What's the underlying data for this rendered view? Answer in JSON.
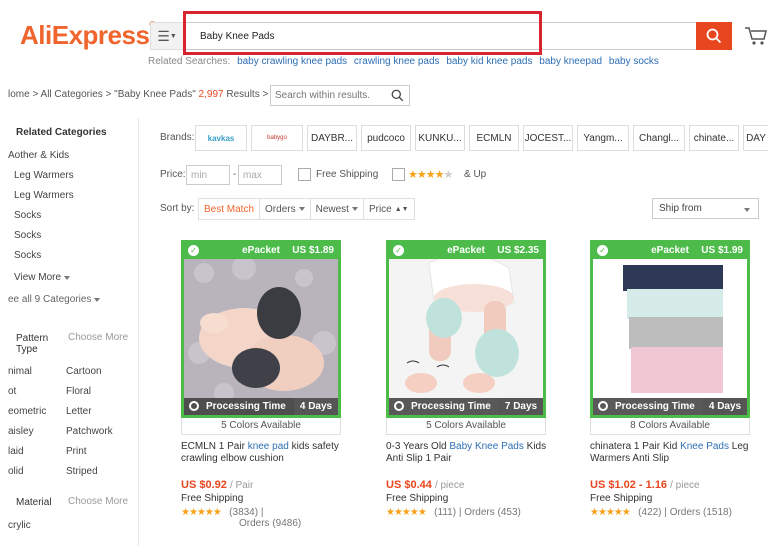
{
  "header": {
    "logo": "AliExpress",
    "logo_tm": "®",
    "search_value": "Baby Knee Pads",
    "related_label": "Related Searches:",
    "related": [
      "baby crawling knee pads",
      "crawling knee pads",
      "baby kid knee pads",
      "baby kneepad",
      "baby socks"
    ]
  },
  "breadcrumb": {
    "path": "lome > All Categories > \"Baby Knee Pads\"",
    "count": "2,997",
    "results": "Results >",
    "within_placeholder": "Search within results."
  },
  "sidebar": {
    "related_title": "Related Categories",
    "categories": [
      "Aother & Kids",
      "Leg Warmers",
      "Leg Warmers",
      "Socks",
      "Socks",
      "Socks"
    ],
    "view_more": "View More",
    "see_all": "ee all 9 Categories",
    "pattern_title_1": "Pattern",
    "pattern_title_2": "Type",
    "choose_more": "Choose More",
    "patterns_left": [
      "nimal",
      "ot",
      "eometric",
      "aisley",
      "laid",
      "olid"
    ],
    "patterns_right": [
      "Cartoon",
      "Floral",
      "Letter",
      "Patchwork",
      "Print",
      "Striped"
    ],
    "material_title": "Material",
    "material_choose": "Choose More",
    "materials": [
      "crylic"
    ]
  },
  "filters": {
    "brands_label": "Brands:",
    "brands": [
      "kavkas",
      "babygo",
      "DAYBR...",
      "pudcoco",
      "KUNKU...",
      "ECMLN",
      "JOCEST...",
      "Yangm...",
      "Changl...",
      "chinate...",
      "DAY"
    ],
    "price_label": "Price:",
    "min_placeholder": "min",
    "max_placeholder": "max",
    "dash": "-",
    "free_shipping": "Free Shipping",
    "and_up": "& Up",
    "sort_label": "Sort by:",
    "sort": [
      "Best Match",
      "Orders",
      "Newest",
      "Price"
    ],
    "ship_from": "Ship from"
  },
  "products": [
    {
      "epacket": "ePacket",
      "badge_price": "US $1.89",
      "processing": "Processing Time",
      "days": "4 Days",
      "colors": "5 Colors Available",
      "title_a": "ECMLN 1 Pair ",
      "title_b": "knee pad",
      "title_c": " kids safety crawling elbow cushion",
      "price": "US $0.92",
      "unit": "/ Pair",
      "free": "Free Shipping",
      "reviews": "(3834)",
      "orders": "Orders (9486)"
    },
    {
      "epacket": "ePacket",
      "badge_price": "US $2.35",
      "processing": "Processing Time",
      "days": "7 Days",
      "colors": "5 Colors Available",
      "title_a": "0-3 Years Old ",
      "title_b": "Baby Knee Pads",
      "title_c": " Kids Anti Slip 1 Pair",
      "price": "US $0.44",
      "unit": "/ piece",
      "free": "Free Shipping",
      "reviews": "(111)",
      "orders": "Orders (453)"
    },
    {
      "epacket": "ePacket",
      "badge_price": "US $1.99",
      "processing": "Processing Time",
      "days": "4 Days",
      "colors": "8 Colors Available",
      "title_a": "chinatera 1 Pair Kid ",
      "title_b": "Knee Pads",
      "title_c": " Leg Warmers Anti Slip",
      "price": "US $1.02 - 1.16",
      "unit": "/ piece",
      "free": "Free Shipping",
      "reviews": "(422)",
      "orders": "Orders (1518)"
    }
  ],
  "colors": {
    "brand": "#f0652d",
    "search_button": "#e8461e",
    "highlight": "#d9232e",
    "epacket": "#4cbb4a",
    "link": "#2f6fb4"
  }
}
